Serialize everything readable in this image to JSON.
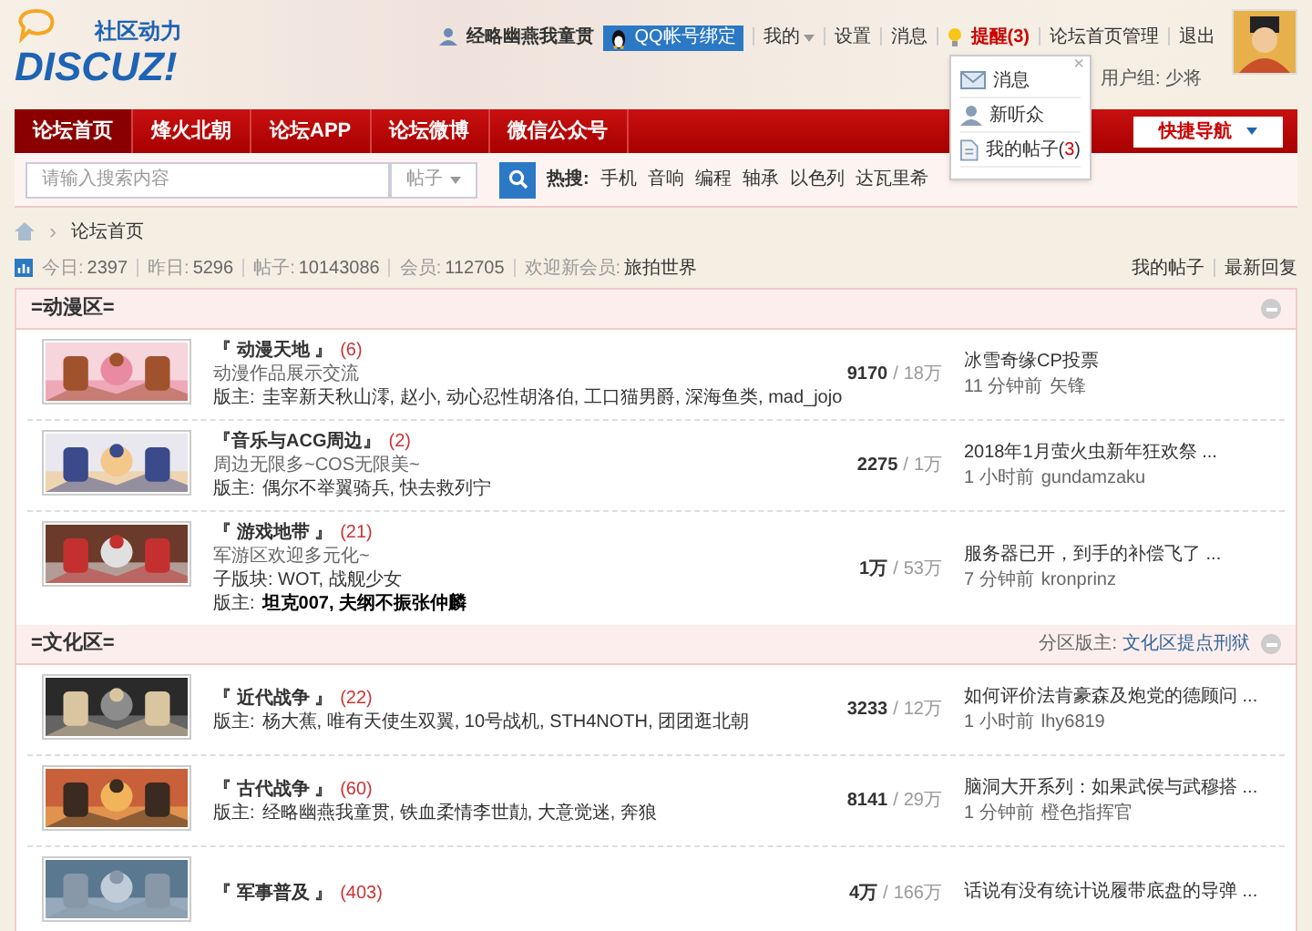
{
  "header": {
    "logo_tagline": "社区动力",
    "logo_text": "DISCUZ!",
    "user": "经略幽燕我童贯",
    "qq_bind": "QQ帐号绑定",
    "links": [
      {
        "label": "我的",
        "dropdown": true
      },
      {
        "label": "设置",
        "dropdown": false
      },
      {
        "label": "消息",
        "dropdown": false
      }
    ],
    "reminder": {
      "label": "提醒",
      "count": "(3)"
    },
    "admin_links": [
      "论坛首页管理",
      "退出"
    ],
    "user_group": "用户组: 少将"
  },
  "popup": {
    "close": "×",
    "items": [
      {
        "kind": "mail",
        "label": "消息"
      },
      {
        "kind": "person",
        "label": "新听众"
      },
      {
        "kind": "doc",
        "label": "我的帖子",
        "count": "3",
        "paren_open": "(",
        "paren_close": ")"
      }
    ]
  },
  "nav": {
    "items": [
      {
        "label": "论坛首页",
        "selected": true
      },
      {
        "label": "烽火北朝",
        "selected": false
      },
      {
        "label": "论坛APP",
        "selected": false
      },
      {
        "label": "论坛微博",
        "selected": false
      },
      {
        "label": "微信公众号",
        "selected": false
      }
    ],
    "quick_nav": "快捷导航"
  },
  "search": {
    "placeholder": "请输入搜索内容",
    "scope": "帖子",
    "hot_label": "热搜:",
    "hot": [
      "手机",
      "音响",
      "编程",
      "轴承",
      "以色列",
      "达瓦里希"
    ]
  },
  "breadcrumb": [
    {
      "separator": "›",
      "label": "论坛首页"
    }
  ],
  "stats": [
    {
      "label": "今日:",
      "value": "2397"
    },
    {
      "label": "昨日:",
      "value": "5296"
    },
    {
      "label": "帖子:",
      "value": "10143086"
    },
    {
      "label": "会员:",
      "value": "112705"
    },
    {
      "label": "欢迎新会员:",
      "value": "旅拍世界"
    }
  ],
  "stats_links": [
    "我的帖子",
    "最新回复"
  ],
  "sections": [
    {
      "title": "=动漫区=",
      "forums": [
        {
          "title": "『 动漫天地 』",
          "count": "(6)",
          "desc": "动漫作品展示交流",
          "moderators_label": "版主:",
          "moderators": "圭宰新天秋山澪, 赵小, 动心忍性胡洛伯, 工口猫男爵, 深海鱼类, mad_jojo",
          "moderators_bold": false,
          "topics": "9170",
          "sep": "/",
          "posts": "18万",
          "last_title": "冰雪奇缘CP投票",
          "last_time": "11 分钟前",
          "last_user": "矢锋"
        },
        {
          "title": "『音乐与ACG周边』",
          "count": "(2)",
          "desc": "周边无限多~COS无限美~",
          "moderators_label": "版主:",
          "moderators": "偶尔不举翼骑兵, 快去救列宁",
          "moderators_bold": false,
          "topics": "2275",
          "sep": "/",
          "posts": "1万",
          "last_title": "2018年1月萤火虫新年狂欢祭 ...",
          "last_time": "1 小时前",
          "last_user": "gundamzaku"
        },
        {
          "title": "『 游戏地带 』",
          "count": "(21)",
          "desc": "军游区欢迎多元化~",
          "subforums": "子版块: WOT, 战舰少女",
          "moderators_label": "版主:",
          "moderators": "坦克007, 夫纲不振张仲麟",
          "moderators_bold": true,
          "topics": "1万",
          "sep": "/",
          "posts": "53万",
          "last_title": "服务器已开，到手的补偿飞了 ...",
          "last_time": "7 分钟前",
          "last_user": "kronprinz"
        }
      ]
    },
    {
      "title": "=文化区=",
      "section_mod_label": "分区版主:",
      "section_mod": "文化区提点刑狱",
      "forums": [
        {
          "title": "『 近代战争 』",
          "count": "(22)",
          "moderators_label": "版主:",
          "moderators": "杨大蕉, 唯有天使生双翼, 10号战机, STH4NOTH, 团团逛北朝",
          "moderators_bold": false,
          "topics": "3233",
          "sep": "/",
          "posts": "12万",
          "last_title": "如何评价法肯豪森及炮党的德顾问 ...",
          "last_time": "1 小时前",
          "last_user": "lhy6819"
        },
        {
          "title": "『 古代战争 』",
          "count": "(60)",
          "moderators_label": "版主:",
          "moderators": "经略幽燕我童贯, 铁血柔情李世勣, 大意觉迷, 奔狼",
          "moderators_bold": false,
          "topics": "8141",
          "sep": "/",
          "posts": "29万",
          "last_title": "脑洞大开系列：如果武侯与武穆搭 ...",
          "last_time": "1 分钟前",
          "last_user": "橙色指挥官"
        },
        {
          "title": "『 军事普及 』",
          "count": "(403)",
          "topics": "4万",
          "sep": "/",
          "posts": "166万",
          "last_title": "话说有没有统计说履带底盘的导弹 ..."
        }
      ]
    }
  ]
}
